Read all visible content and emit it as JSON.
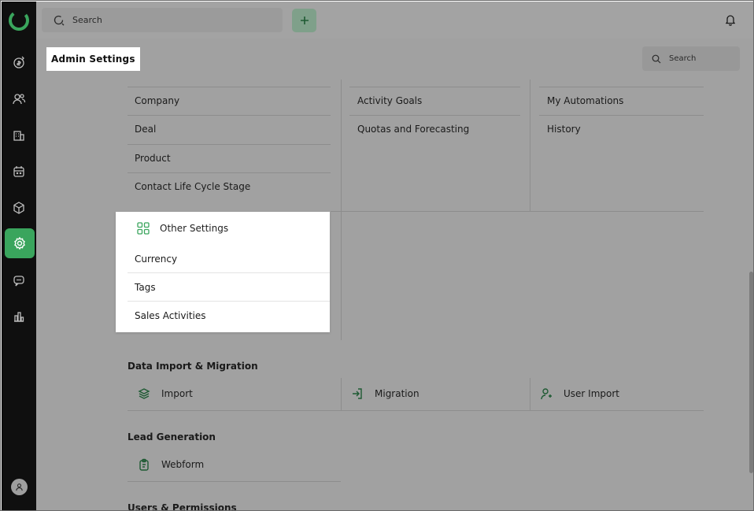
{
  "topbar": {
    "search_placeholder": "Search"
  },
  "header": {
    "title": "Admin Settings",
    "search_placeholder": "Search"
  },
  "columns": {
    "col1": [
      "Company",
      "Deal",
      "Product",
      "Contact Life Cycle Stage"
    ],
    "col2": [
      "Activity Goals",
      "Quotas and Forecasting"
    ],
    "col3": [
      "My Automations",
      "History"
    ]
  },
  "popup": {
    "title": "Other Settings",
    "items": [
      "Currency",
      "Tags",
      "Sales Activities"
    ]
  },
  "sections": {
    "data_import": {
      "title": "Data Import & Migration",
      "items": [
        "Import",
        "Migration",
        "User Import"
      ]
    },
    "lead_generation": {
      "title": "Lead Generation",
      "items": [
        "Webform"
      ]
    },
    "users_permissions": {
      "title": "Users & Permissions"
    }
  },
  "colors": {
    "accent": "#3aa55d",
    "sidebar": "#0f0f0f",
    "overlay_gray": "#a1a1a1"
  },
  "icons": {
    "sidebar": [
      "deals-icon",
      "contacts-icon",
      "companies-icon",
      "calendar-icon",
      "products-icon",
      "settings-icon",
      "chat-icon",
      "reports-icon"
    ]
  }
}
